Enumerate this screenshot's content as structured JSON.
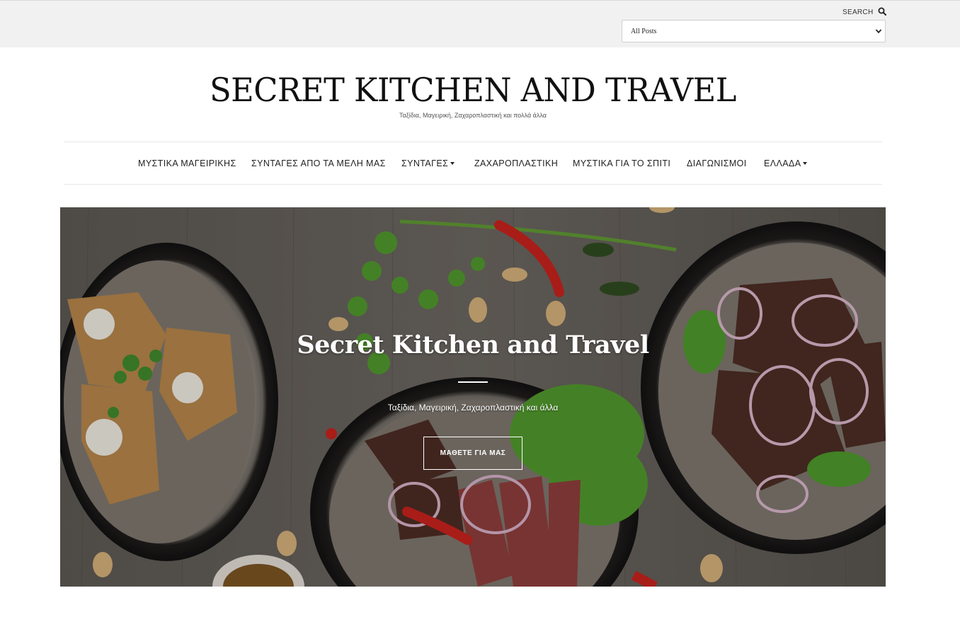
{
  "topbar": {
    "search_label": "SEARCH",
    "search_icon": "search-icon",
    "select_value": "All Posts",
    "select_icon": "chevron-down-icon"
  },
  "header": {
    "title": "SECRET KITCHEN AND TRAVEL",
    "tagline": "Ταξίδια, Μαγειρική, Ζαχαροπλαστική και πολλά άλλα"
  },
  "nav": {
    "items": [
      {
        "label": "ΜΥΣΤΙΚΑ ΜΑΓΕΙΡΙΚΗΣ",
        "dropdown": false
      },
      {
        "label": "ΣΥΝΤΑΓΕΣ ΑΠΟ ΤΑ ΜΕΛΗ ΜΑΣ",
        "dropdown": false
      },
      {
        "label": "ΣΥΝΤΑΓΕΣ",
        "dropdown": true
      },
      {
        "label": "ΖΑΧΑΡΟΠΛΑΣΤΙΚΗ",
        "dropdown": false
      },
      {
        "label": "ΜΥΣΤΙΚΑ ΓΙΑ ΤΟ ΣΠΙΤΙ",
        "dropdown": false
      },
      {
        "label": "ΔΙΑΓΩΝΙΣΜΟΙ",
        "dropdown": false
      },
      {
        "label": "ΕΛΛΑΔΑ",
        "dropdown": true
      }
    ]
  },
  "hero": {
    "title": "Secret Kitchen and Travel",
    "subtitle": "Ταξίδια, Μαγειρική, Ζαχαροπλαστική και άλλα",
    "button_label": "ΜΑΘΕΤΕ ΓΙΑ ΜΑΣ"
  }
}
